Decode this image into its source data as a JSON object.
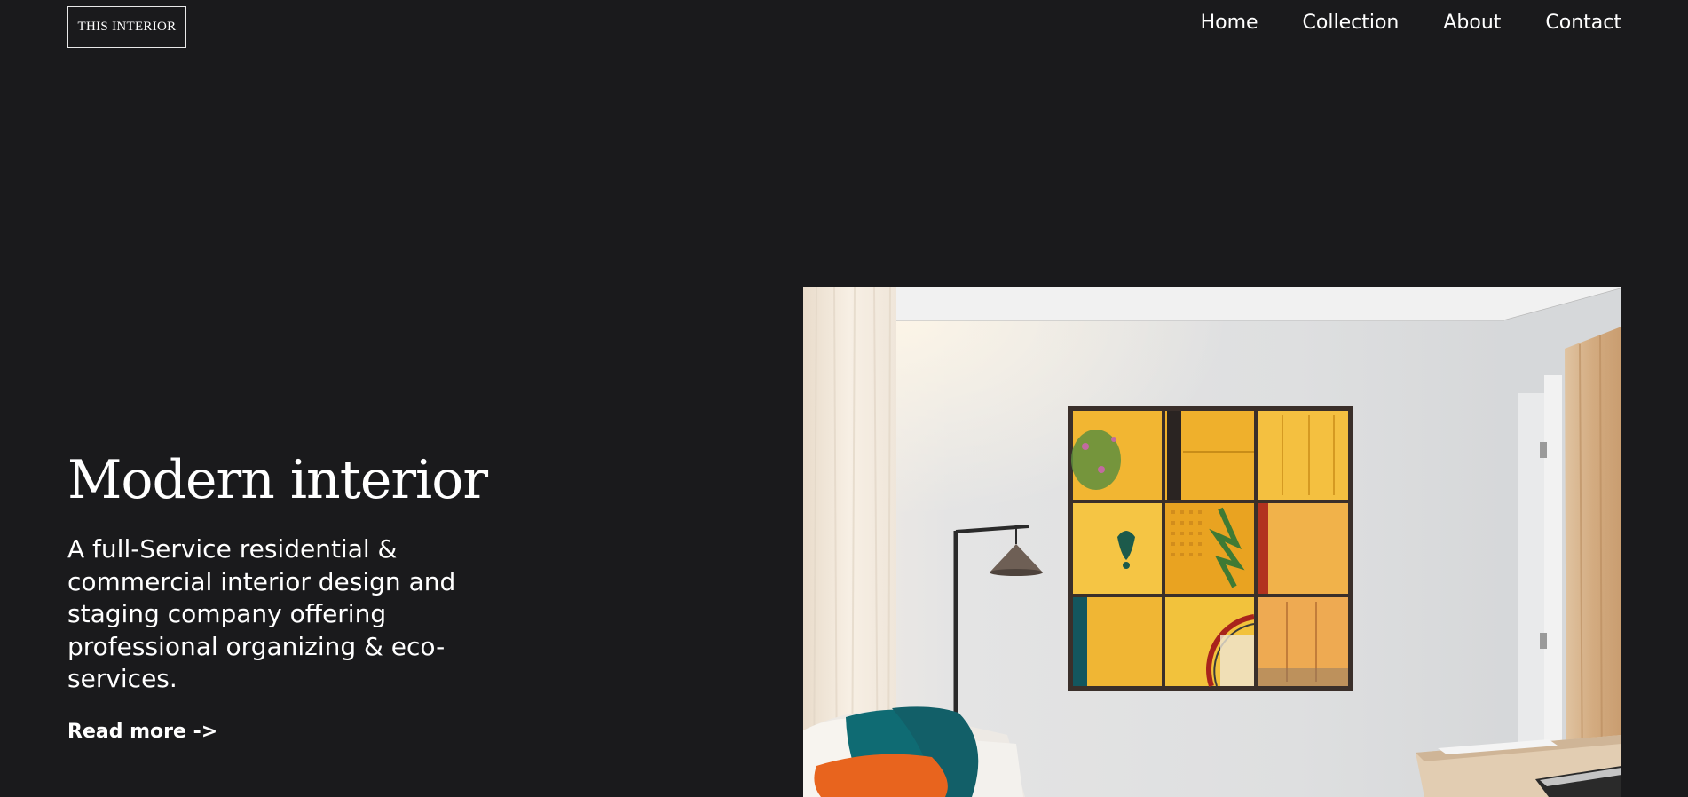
{
  "header": {
    "logo_text": "THIS INTERIOR",
    "nav": [
      {
        "label": "Home"
      },
      {
        "label": "Collection"
      },
      {
        "label": "About"
      },
      {
        "label": "Contact"
      }
    ]
  },
  "hero": {
    "title": "Modern interior",
    "description": "A full-Service residential & commercial interior design and staging company offering professional organizing & eco-services.",
    "cta_label": "Read more ->"
  },
  "colors": {
    "background": "#1a1a1c",
    "text": "#ffffff",
    "panel_yellow": "#f2b632",
    "pillow_orange": "#e8641e",
    "pillow_teal": "#0f6b73"
  }
}
